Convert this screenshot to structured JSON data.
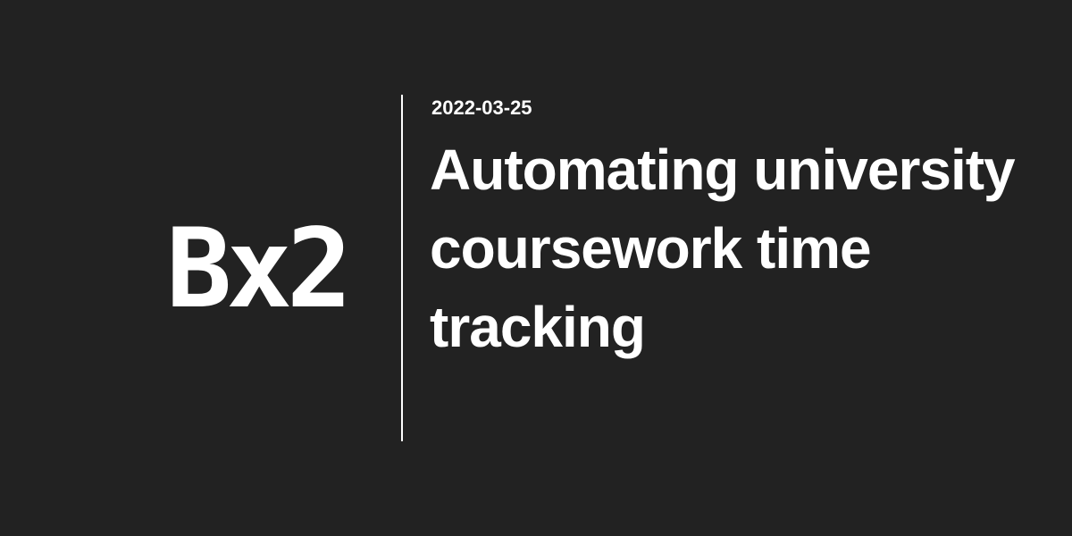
{
  "brand": {
    "logo_text": "Bx2"
  },
  "post": {
    "date": "2022-03-25",
    "title": "Automating university coursework time tracking"
  },
  "colors": {
    "background": "#222222",
    "foreground": "#ffffff"
  }
}
